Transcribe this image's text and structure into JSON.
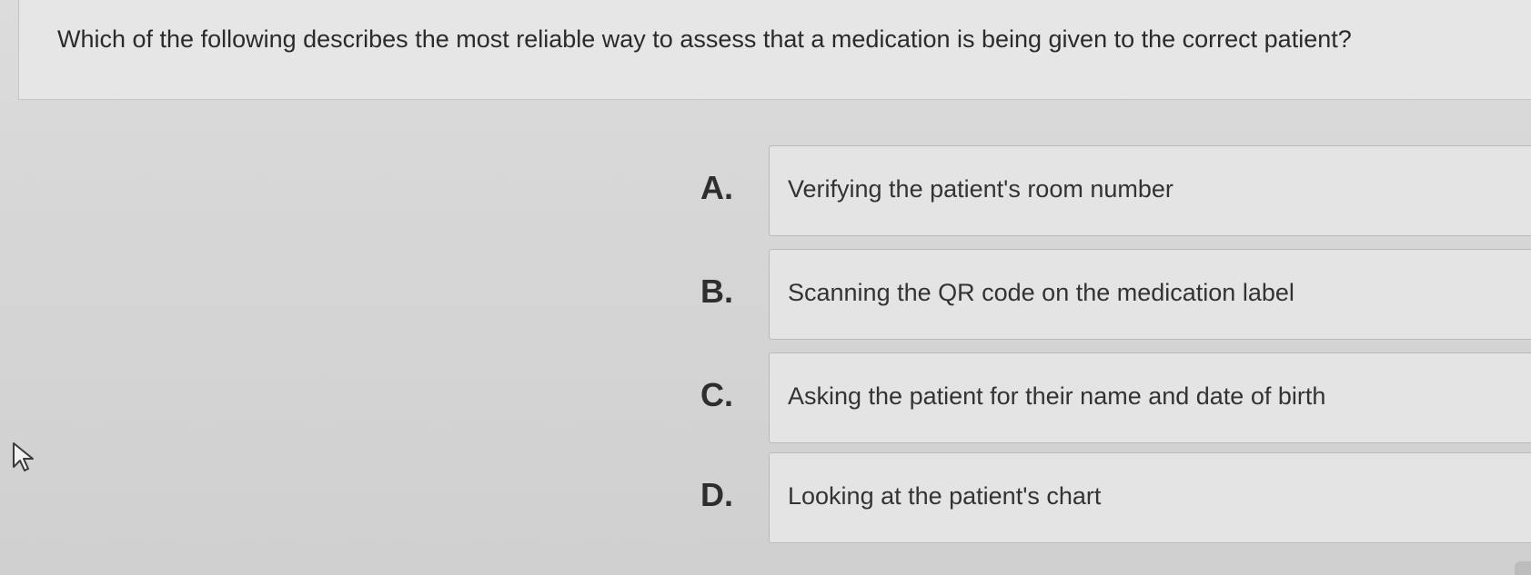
{
  "question": {
    "text": "Which of the following describes the most reliable way to assess that a medication is being given to the correct patient?"
  },
  "options": [
    {
      "letter": "A.",
      "text": "Verifying the patient's room number"
    },
    {
      "letter": "B.",
      "text": "Scanning the QR code on the medication label"
    },
    {
      "letter": "C.",
      "text": "Asking the patient for their name and date of birth"
    },
    {
      "letter": "D.",
      "text": "Looking at the patient's chart"
    }
  ],
  "icons": {
    "cursor": "mouse-pointer-icon"
  }
}
